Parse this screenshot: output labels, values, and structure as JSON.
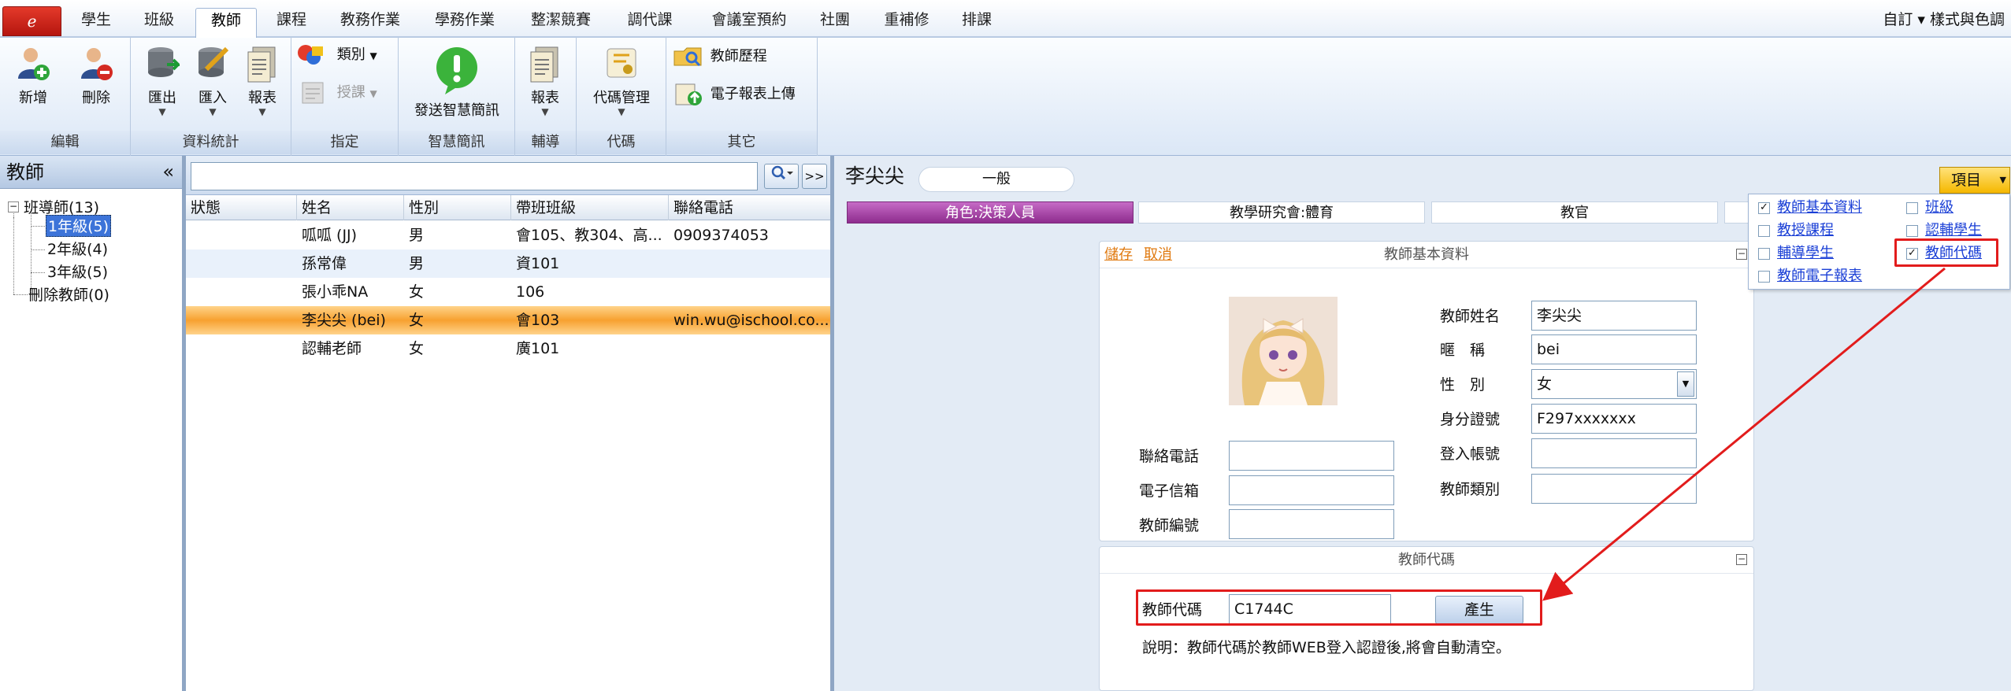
{
  "app_button": {
    "glyph": "ℯ"
  },
  "menu": {
    "tabs": [
      "學生",
      "班級",
      "教師",
      "課程",
      "教務作業",
      "學務作業",
      "整潔競賽",
      "調代課",
      "會議室預約",
      "社團",
      "重補修",
      "排課"
    ],
    "active_tab": "教師",
    "right": "自訂 ▾  樣式與色調"
  },
  "ribbon": {
    "groups": {
      "edit": {
        "label": "編輯",
        "add": "新增",
        "delete": "刪除"
      },
      "data_stats": {
        "label": "資料統計",
        "export": "匯出",
        "import": "匯入",
        "report": "報表"
      },
      "assign": {
        "label": "指定",
        "category": "類別",
        "teach": "授課"
      },
      "smart_msg": {
        "label": "智慧簡訊",
        "send": "發送智慧簡訊"
      },
      "tutor": {
        "label": "輔導",
        "report": "報表"
      },
      "code": {
        "label": "代碼",
        "manage": "代碼管理"
      },
      "other": {
        "label": "其它",
        "history": "教師歷程",
        "upload": "電子報表上傳"
      }
    }
  },
  "tree": {
    "title": "教師",
    "collapse": "«",
    "nodes": {
      "homeroom": "班導師(13)",
      "grade1": "1年級(5)",
      "grade2": "2年級(4)",
      "grade3": "3年級(5)",
      "deleted": "刪除教師(0)"
    }
  },
  "list": {
    "search_value": "",
    "expand": ">>",
    "columns": [
      "狀態",
      "姓名",
      "性別",
      "帶班班級",
      "聯絡電話"
    ],
    "rows": [
      {
        "status": "",
        "name": "呱呱 (JJ)",
        "gender": "男",
        "class": "會105、教304、高...",
        "phone": "0909374053"
      },
      {
        "status": "",
        "name": "孫常偉",
        "gender": "男",
        "class": "資101",
        "phone": ""
      },
      {
        "status": "",
        "name": "張小乖NA",
        "gender": "女",
        "class": "106",
        "phone": ""
      },
      {
        "status": "",
        "name": "李尖尖 (bei)",
        "gender": "女",
        "class": "會103",
        "phone": "win.wu@ischool.co..."
      },
      {
        "status": "",
        "name": "認輔老師",
        "gender": "女",
        "class": "廣101",
        "phone": ""
      }
    ]
  },
  "detail": {
    "name": "李尖尖",
    "tag": "一般",
    "items_button": "項目",
    "role_tabs": [
      "角色:決策人員",
      "教學研究會:體育",
      "教官"
    ],
    "basic": {
      "title": "教師基本資料",
      "save": "儲存",
      "cancel": "取消",
      "fields": {
        "name": {
          "label": "教師姓名",
          "value": "李尖尖"
        },
        "nickname": {
          "label": "暱　稱",
          "value": "bei"
        },
        "gender": {
          "label": "性　別",
          "value": "女"
        },
        "id_no": {
          "label": "身分證號",
          "value": "F297xxxxxxx"
        },
        "login": {
          "label": "登入帳號",
          "value": ""
        },
        "category": {
          "label": "教師類別",
          "value": ""
        },
        "phone": {
          "label": "聯絡電話",
          "value": ""
        },
        "email": {
          "label": "電子信箱",
          "value": ""
        },
        "number": {
          "label": "教師編號",
          "value": ""
        }
      }
    },
    "code": {
      "title": "教師代碼",
      "label": "教師代碼",
      "value": "C1744C",
      "button": "產生",
      "note": "說明：教師代碼於教師WEB登入認證後,將會自動清空。"
    }
  },
  "items_popup": {
    "items": [
      {
        "label": "教師基本資料",
        "checked": true
      },
      {
        "label": "班級",
        "checked": false
      },
      {
        "label": "教授課程",
        "checked": false
      },
      {
        "label": "認輔學生",
        "checked": false
      },
      {
        "label": "輔導學生",
        "checked": false
      },
      {
        "label": "教師代碼",
        "checked": true
      },
      {
        "label": "教師電子報表",
        "checked": false
      }
    ]
  },
  "colors": {
    "accent_orange": "#f7a130",
    "annotation_red": "#e21c1c",
    "link_blue": "#1a3fd6",
    "role_purple": "#8e2c8e"
  }
}
